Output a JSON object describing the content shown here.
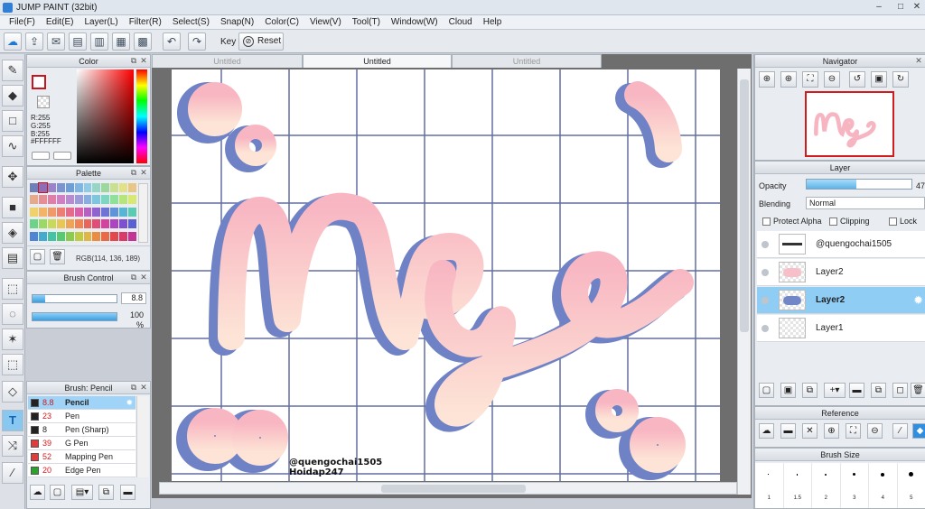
{
  "window": {
    "title": "JUMP PAINT (32bit)",
    "controls": [
      "–",
      "□",
      "✕"
    ]
  },
  "menu": [
    "File(F)",
    "Edit(E)",
    "Layer(L)",
    "Filter(R)",
    "Select(S)",
    "Snap(N)",
    "Color(C)",
    "View(V)",
    "Tool(T)",
    "Window(W)",
    "Cloud",
    "Help"
  ],
  "toolbar": {
    "key_label": "Key",
    "reset_label": "Reset"
  },
  "tabs": [
    "Untitled",
    "Untitled",
    "Untitled"
  ],
  "color_panel": {
    "title": "Color",
    "r": "R:255",
    "g": "G:255",
    "b": "B:255",
    "hex": "#FFFFFF",
    "fg_color": "#c7161e",
    "bg_color": "#ffffff"
  },
  "palette_panel": {
    "title": "Palette",
    "rgb_readout": "RGB(114, 136, 189)",
    "swatches": [
      "#6f7fb8",
      "#8c6fb6",
      "#9a84c8",
      "#7b93cf",
      "#6d9ed6",
      "#7fb7e2",
      "#8fcbe6",
      "#95d6c6",
      "#9ed79d",
      "#c8e08f",
      "#e3e08a",
      "#e9c685",
      "#e7a98c",
      "#e48e96",
      "#df7fa8",
      "#d17fc3",
      "#b88ad0",
      "#9d9ad8",
      "#86aee0",
      "#7ec6dd",
      "#7ed6c0",
      "#8fe09a",
      "#b6e57c",
      "#d9e872",
      "#f0d26b",
      "#f2b468",
      "#f09a6a",
      "#ec7e74",
      "#e76a8a",
      "#d95fa8",
      "#b85fc6",
      "#8f63d0",
      "#6e74d6",
      "#5f95d8",
      "#58b6d4",
      "#5dcbb1",
      "#6fd28a",
      "#9bd866",
      "#c9d95b",
      "#e6c758",
      "#eea457",
      "#ee8455",
      "#e9655b",
      "#e24d78",
      "#d2449d",
      "#ad45bf",
      "#7e4fce",
      "#5a5fd3",
      "#4f85d2",
      "#47a9cc",
      "#48c2a4",
      "#58c873",
      "#8bcb4f",
      "#bfca45",
      "#e0b645",
      "#ea8d44",
      "#e86a46",
      "#e2484c",
      "#d93a6a",
      "#c43494"
    ]
  },
  "brush_control": {
    "title": "Brush Control",
    "size_value": "8.8",
    "opacity_value": "100 %",
    "size_fraction": 0.15,
    "opacity_fraction": 1.0
  },
  "brush_panel": {
    "title": "Brush: Pencil",
    "items": [
      {
        "size": "8.8",
        "name": "Pencil",
        "color": "#222222"
      },
      {
        "size": "23",
        "name": "Pen",
        "color": "#222222"
      },
      {
        "size": "8",
        "name": "Pen (Sharp)",
        "color": "#222222"
      },
      {
        "size": "39",
        "name": "G Pen",
        "color": "#e33b3b"
      },
      {
        "size": "52",
        "name": "Mapping Pen",
        "color": "#e33b3b"
      },
      {
        "size": "20",
        "name": "Edge Pen",
        "color": "#2aa32a"
      }
    ]
  },
  "navigator": {
    "title": "Navigator"
  },
  "layer_panel": {
    "title": "Layer",
    "opacity_label": "Opacity",
    "opacity_value": "47",
    "opacity_fraction": 0.47,
    "blending_label": "Blending",
    "blending_value": "Normal",
    "protect_alpha": "Protect Alpha",
    "clipping": "Clipping",
    "lock": "Lock",
    "layers": [
      {
        "name": "@quengochai1505"
      },
      {
        "name": "Layer2"
      },
      {
        "name": "Layer2"
      },
      {
        "name": "Layer1"
      }
    ]
  },
  "reference_panel": {
    "title": "Reference"
  },
  "brush_size_panel": {
    "title": "Brush Size",
    "sizes": [
      "1",
      "1.5",
      "2",
      "3",
      "4",
      "5"
    ]
  },
  "canvas": {
    "watermark_line1": "@quengochai1505",
    "watermark_line2": "Hoidap247"
  }
}
